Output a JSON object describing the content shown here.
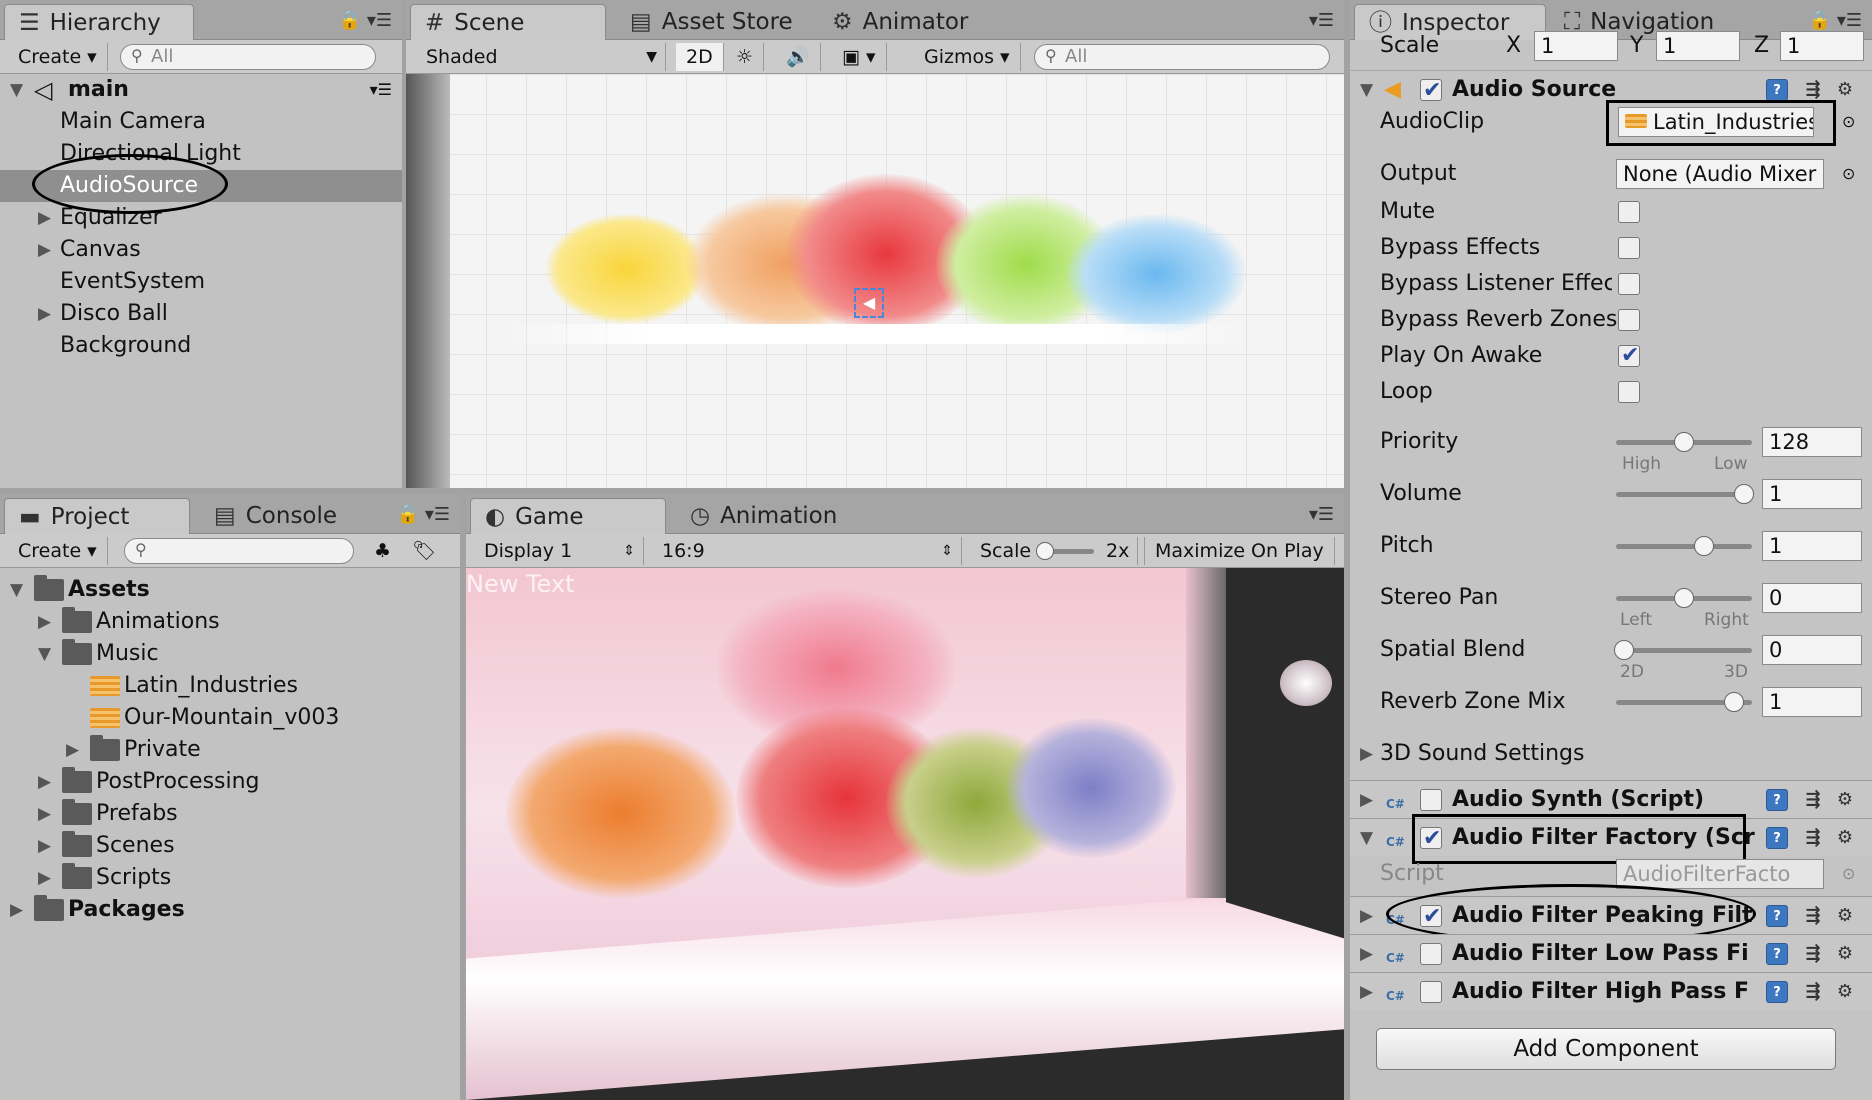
{
  "hierarchy": {
    "tab": "Hierarchy",
    "create": "Create",
    "search_placeholder": "All",
    "scene": "main",
    "items": [
      {
        "label": "Main Camera"
      },
      {
        "label": "Directional Light"
      },
      {
        "label": "AudioSource",
        "selected": true
      },
      {
        "label": "Equalizer"
      },
      {
        "label": "Canvas"
      },
      {
        "label": "EventSystem"
      },
      {
        "label": "Disco Ball"
      },
      {
        "label": "Background"
      }
    ]
  },
  "scene": {
    "tabs": [
      "Scene",
      "Asset Store",
      "Animator"
    ],
    "shading": "Shaded",
    "mode_2d": "2D",
    "gizmos": "Gizmos",
    "search_placeholder": "All"
  },
  "project": {
    "tabs": [
      "Project",
      "Console"
    ],
    "create": "Create",
    "tree": [
      {
        "label": "Assets"
      },
      {
        "label": "Animations"
      },
      {
        "label": "Music"
      },
      {
        "label": "Latin_Industries"
      },
      {
        "label": "Our-Mountain_v003"
      },
      {
        "label": "Private"
      },
      {
        "label": "PostProcessing"
      },
      {
        "label": "Prefabs"
      },
      {
        "label": "Scenes"
      },
      {
        "label": "Scripts"
      },
      {
        "label": "Packages"
      }
    ]
  },
  "game": {
    "tabs": [
      "Game",
      "Animation"
    ],
    "display": "Display 1",
    "aspect": "16:9",
    "scale_label": "Scale",
    "scale_value": "2x",
    "maximize": "Maximize On Play",
    "overlay_text": "New Text"
  },
  "inspector": {
    "tabs": [
      "Inspector",
      "Navigation"
    ],
    "scale": {
      "label": "Scale",
      "x_label": "X",
      "x": "1",
      "y_label": "Y",
      "y": "1",
      "z_label": "Z",
      "z": "1"
    },
    "audio_source": {
      "title": "Audio Source",
      "audioclip_label": "AudioClip",
      "audioclip_value": "Latin_Industries",
      "output_label": "Output",
      "output_value": "None (Audio Mixer",
      "checks": [
        {
          "label": "Mute",
          "checked": false
        },
        {
          "label": "Bypass Effects",
          "checked": false
        },
        {
          "label": "Bypass Listener Effects",
          "checked": false
        },
        {
          "label": "Bypass Reverb Zones",
          "checked": false
        },
        {
          "label": "Play On Awake",
          "checked": true
        },
        {
          "label": "Loop",
          "checked": false
        }
      ],
      "sliders": [
        {
          "label": "Priority",
          "value": "128",
          "level": 0.5,
          "min_label": "High",
          "max_label": "Low"
        },
        {
          "label": "Volume",
          "value": "1",
          "level": 0.95
        },
        {
          "label": "Pitch",
          "value": "1",
          "level": 0.65
        },
        {
          "label": "Stereo Pan",
          "value": "0",
          "level": 0.5,
          "min_label": "Left",
          "max_label": "Right"
        },
        {
          "label": "Spatial Blend",
          "value": "0",
          "level": 0.0,
          "min_label": "2D",
          "max_label": "3D"
        },
        {
          "label": "Reverb Zone Mix",
          "value": "1",
          "level": 0.85
        }
      ],
      "sound_settings": "3D Sound Settings"
    },
    "components": [
      {
        "title": "Audio Synth (Script)",
        "checked": false
      },
      {
        "title": "Audio Filter Factory (Scr",
        "checked": true,
        "script_label": "Script",
        "script_value": "AudioFilterFacto"
      },
      {
        "title": "Audio Filter Peaking Filt",
        "checked": true
      },
      {
        "title": "Audio Filter Low Pass Fi",
        "checked": false
      },
      {
        "title": "Audio Filter High Pass F",
        "checked": false
      }
    ],
    "add_component": "Add Component"
  },
  "colors": {
    "accent": "#3d77c0",
    "selection": "#8f8f8f"
  }
}
